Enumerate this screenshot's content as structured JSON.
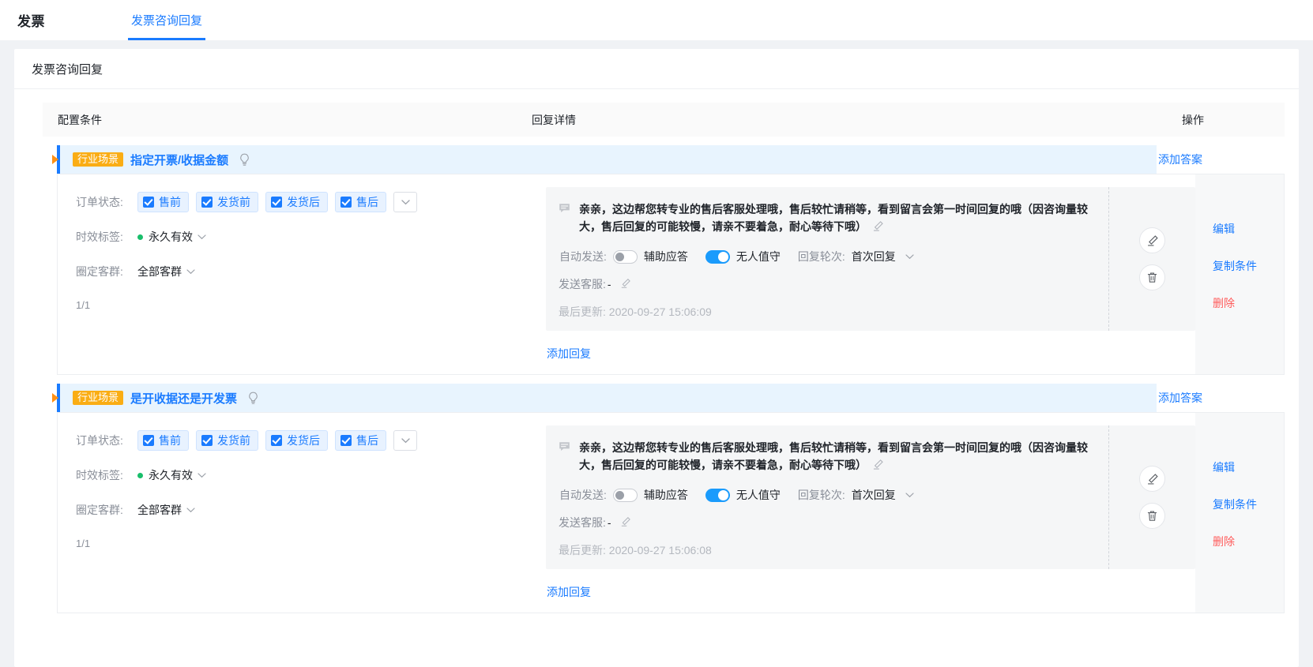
{
  "topbar": {
    "title": "发票",
    "tabs": [
      {
        "label": "发票咨询回复",
        "active": true
      }
    ]
  },
  "panel": {
    "header_title": "发票咨询回复",
    "columns": {
      "condition": "配置条件",
      "reply": "回复详情",
      "operation": "操作"
    }
  },
  "groups": [
    {
      "badge": "行业场景",
      "title": "指定开票/收据金额",
      "bulb_icon": "lightbulb-icon",
      "add_answer": "添加答案",
      "condition": {
        "order_status_label": "订单状态:",
        "order_status_tags": [
          "售前",
          "发货前",
          "发货后",
          "售后"
        ],
        "more_icon": "chevron-down-icon",
        "validity_label": "时效标签:",
        "validity_value": "永久有效",
        "audience_label": "圈定客群:",
        "audience_value": "全部客群",
        "pager": "1/1"
      },
      "reply": {
        "message_icon": "message-bubble-icon",
        "text": "亲亲，这边帮您转专业的售后客服处理哦，售后较忙请稍等，看到留言会第一时间回复的哦（因咨询量较大，售后回复的可能较慢，请亲不要着急，耐心等待下哦）",
        "edit_icon": "pencil-icon",
        "auto_send_label": "自动发送:",
        "assist_toggle": {
          "label": "辅助应答",
          "state": "off"
        },
        "unattended_toggle": {
          "label": "无人值守",
          "state": "on"
        },
        "round_label": "回复轮次:",
        "round_value": "首次回复",
        "agent_label": "发送客服:",
        "agent_value": "-",
        "agent_edit_icon": "pencil-icon",
        "updated_label": "最后更新:",
        "updated_value": "2020-09-27 15:06:09",
        "action_edit_icon": "pencil-circle-icon",
        "action_delete_icon": "trash-circle-icon",
        "add_reply": "添加回复"
      },
      "operations": [
        {
          "label": "编辑",
          "style": "link"
        },
        {
          "label": "复制条件",
          "style": "link"
        },
        {
          "label": "删除",
          "style": "danger"
        }
      ]
    },
    {
      "badge": "行业场景",
      "title": "是开收据还是开发票",
      "bulb_icon": "lightbulb-icon",
      "add_answer": "添加答案",
      "condition": {
        "order_status_label": "订单状态:",
        "order_status_tags": [
          "售前",
          "发货前",
          "发货后",
          "售后"
        ],
        "more_icon": "chevron-down-icon",
        "validity_label": "时效标签:",
        "validity_value": "永久有效",
        "audience_label": "圈定客群:",
        "audience_value": "全部客群",
        "pager": "1/1"
      },
      "reply": {
        "message_icon": "message-bubble-icon",
        "text": "亲亲，这边帮您转专业的售后客服处理哦，售后较忙请稍等，看到留言会第一时间回复的哦（因咨询量较大，售后回复的可能较慢，请亲不要着急，耐心等待下哦）",
        "edit_icon": "pencil-icon",
        "auto_send_label": "自动发送:",
        "assist_toggle": {
          "label": "辅助应答",
          "state": "off"
        },
        "unattended_toggle": {
          "label": "无人值守",
          "state": "on"
        },
        "round_label": "回复轮次:",
        "round_value": "首次回复",
        "agent_label": "发送客服:",
        "agent_value": "-",
        "agent_edit_icon": "pencil-icon",
        "updated_label": "最后更新:",
        "updated_value": "2020-09-27 15:06:08",
        "action_edit_icon": "pencil-circle-icon",
        "action_delete_icon": "trash-circle-icon",
        "add_reply": "添加回复"
      },
      "operations": [
        {
          "label": "编辑",
          "style": "link"
        },
        {
          "label": "复制条件",
          "style": "link"
        },
        {
          "label": "删除",
          "style": "danger"
        }
      ]
    }
  ],
  "colors": {
    "primary": "#1a7bff",
    "badge": "#faad14",
    "danger": "#ff5b5b",
    "caret": "#ff9114",
    "green": "#19be6b"
  }
}
